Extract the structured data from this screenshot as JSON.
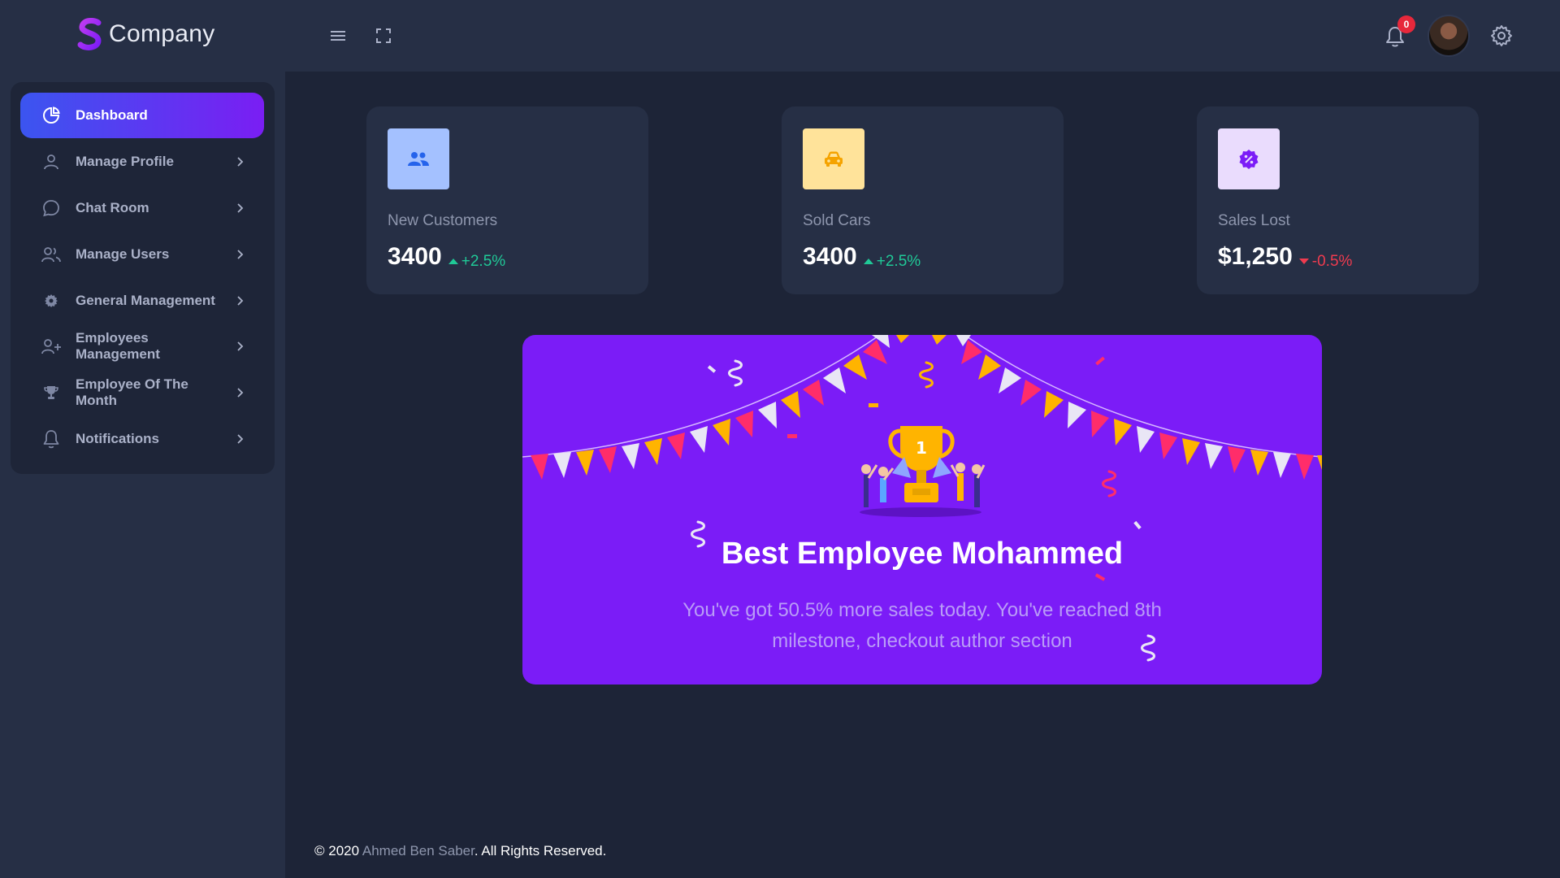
{
  "brand": {
    "name": "Company",
    "logo_icon": "s-logo-icon"
  },
  "header": {
    "menu_icon": "hamburger-icon",
    "fullscreen_icon": "fullscreen-icon",
    "notification_count": "0",
    "settings_icon": "gear-icon"
  },
  "sidebar": {
    "items": [
      {
        "label": "Dashboard",
        "icon": "pie-chart-icon",
        "active": true
      },
      {
        "label": "Manage Profile",
        "icon": "user-icon"
      },
      {
        "label": "Chat Room",
        "icon": "chat-icon"
      },
      {
        "label": "Manage Users",
        "icon": "users-icon"
      },
      {
        "label": "General Management",
        "icon": "cog-icon"
      },
      {
        "label": "Employees Management",
        "icon": "user-plus-icon"
      },
      {
        "label": "Employee Of The Month",
        "icon": "trophy-icon"
      },
      {
        "label": "Notifications",
        "icon": "bell-icon"
      }
    ]
  },
  "cards": [
    {
      "label": "New Customers",
      "value": "3400",
      "change": "+2.5%",
      "trend": "up",
      "icon": "users-icon",
      "icon_bg": "#a4c1ff",
      "icon_color": "#2563eb"
    },
    {
      "label": "Sold Cars",
      "value": "3400",
      "change": "+2.5%",
      "trend": "up",
      "icon": "car-icon",
      "icon_bg": "#ffe39a",
      "icon_color": "#f5a300"
    },
    {
      "label": "Sales Lost",
      "value": "$1,250",
      "change": "-0.5%",
      "trend": "down",
      "icon": "percent-badge-icon",
      "icon_bg": "#eadcfd",
      "icon_color": "#7b1cf7"
    }
  ],
  "banner": {
    "title": "Best Employee Mohammed",
    "text": "You've got 50.5% more sales today. You've reached 8th milestone, checkout author section",
    "background": "#7b1cf7"
  },
  "footer": {
    "prefix": "© 2020 ",
    "author": "Ahmed Ben Saber",
    "suffix": ". All Rights Reserved."
  }
}
